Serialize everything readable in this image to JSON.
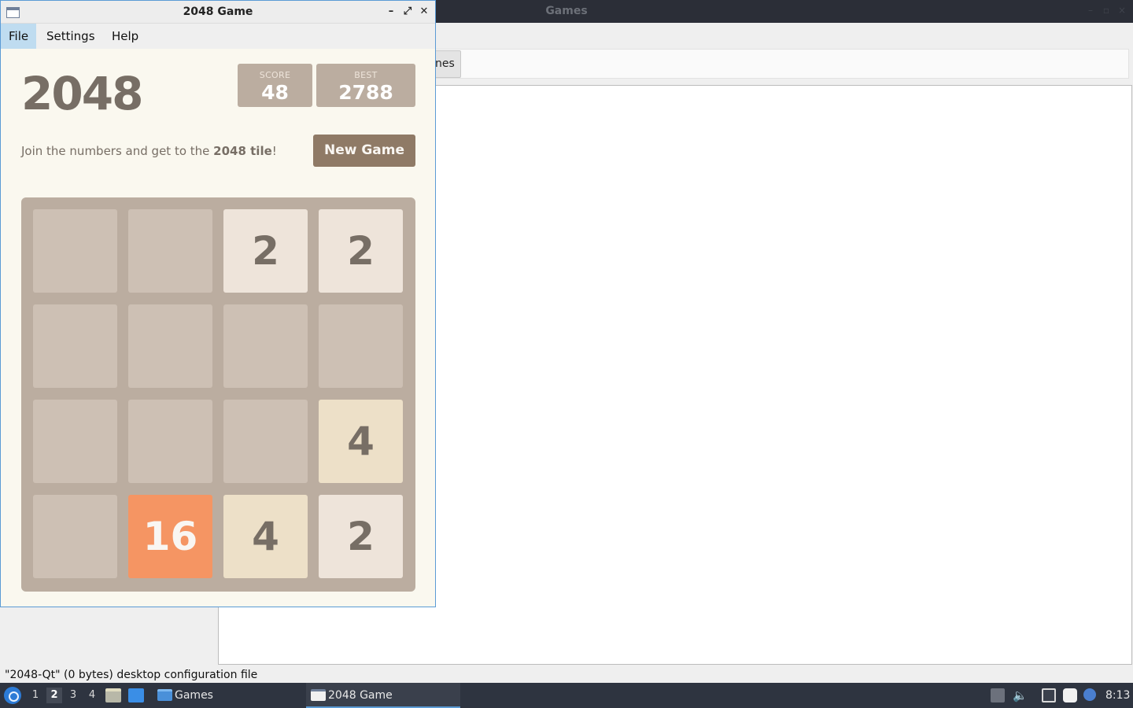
{
  "background_window": {
    "title": "Games",
    "tab_label": "nes",
    "status": "\"2048-Qt\" (0 bytes) desktop configuration file"
  },
  "window": {
    "title": "2048 Game",
    "minimize_icon": "minimize-icon",
    "maximize_icon": "maximize-icon",
    "close_icon": "close-icon"
  },
  "menu": {
    "items": [
      "File",
      "Settings",
      "Help"
    ]
  },
  "game": {
    "title": "2048",
    "score_label": "SCORE",
    "score": "48",
    "best_label": "BEST",
    "best": "2788",
    "tagline_prefix": "Join the numbers and get to the ",
    "tagline_bold": "2048 tile",
    "tagline_suffix": "!",
    "new_game_label": "New Game",
    "board": [
      [
        "",
        "",
        "2",
        "2"
      ],
      [
        "",
        "",
        "",
        ""
      ],
      [
        "",
        "",
        "",
        "4"
      ],
      [
        "",
        "16",
        "4",
        "2"
      ]
    ]
  },
  "taskbar": {
    "workspaces": [
      "1",
      "2",
      "3",
      "4"
    ],
    "active_workspace": "2",
    "tasks": [
      {
        "label": "Games",
        "icon": "folder-icon"
      },
      {
        "label": "2048 Game",
        "icon": "window-icon"
      }
    ],
    "clock": "8:13"
  },
  "colors": {
    "accent": "#5b9bd5",
    "tile_2": "#eee4da",
    "tile_4": "#ede0c8",
    "tile_16": "#f59563",
    "board": "#bbada0",
    "button": "#8f7a66"
  }
}
